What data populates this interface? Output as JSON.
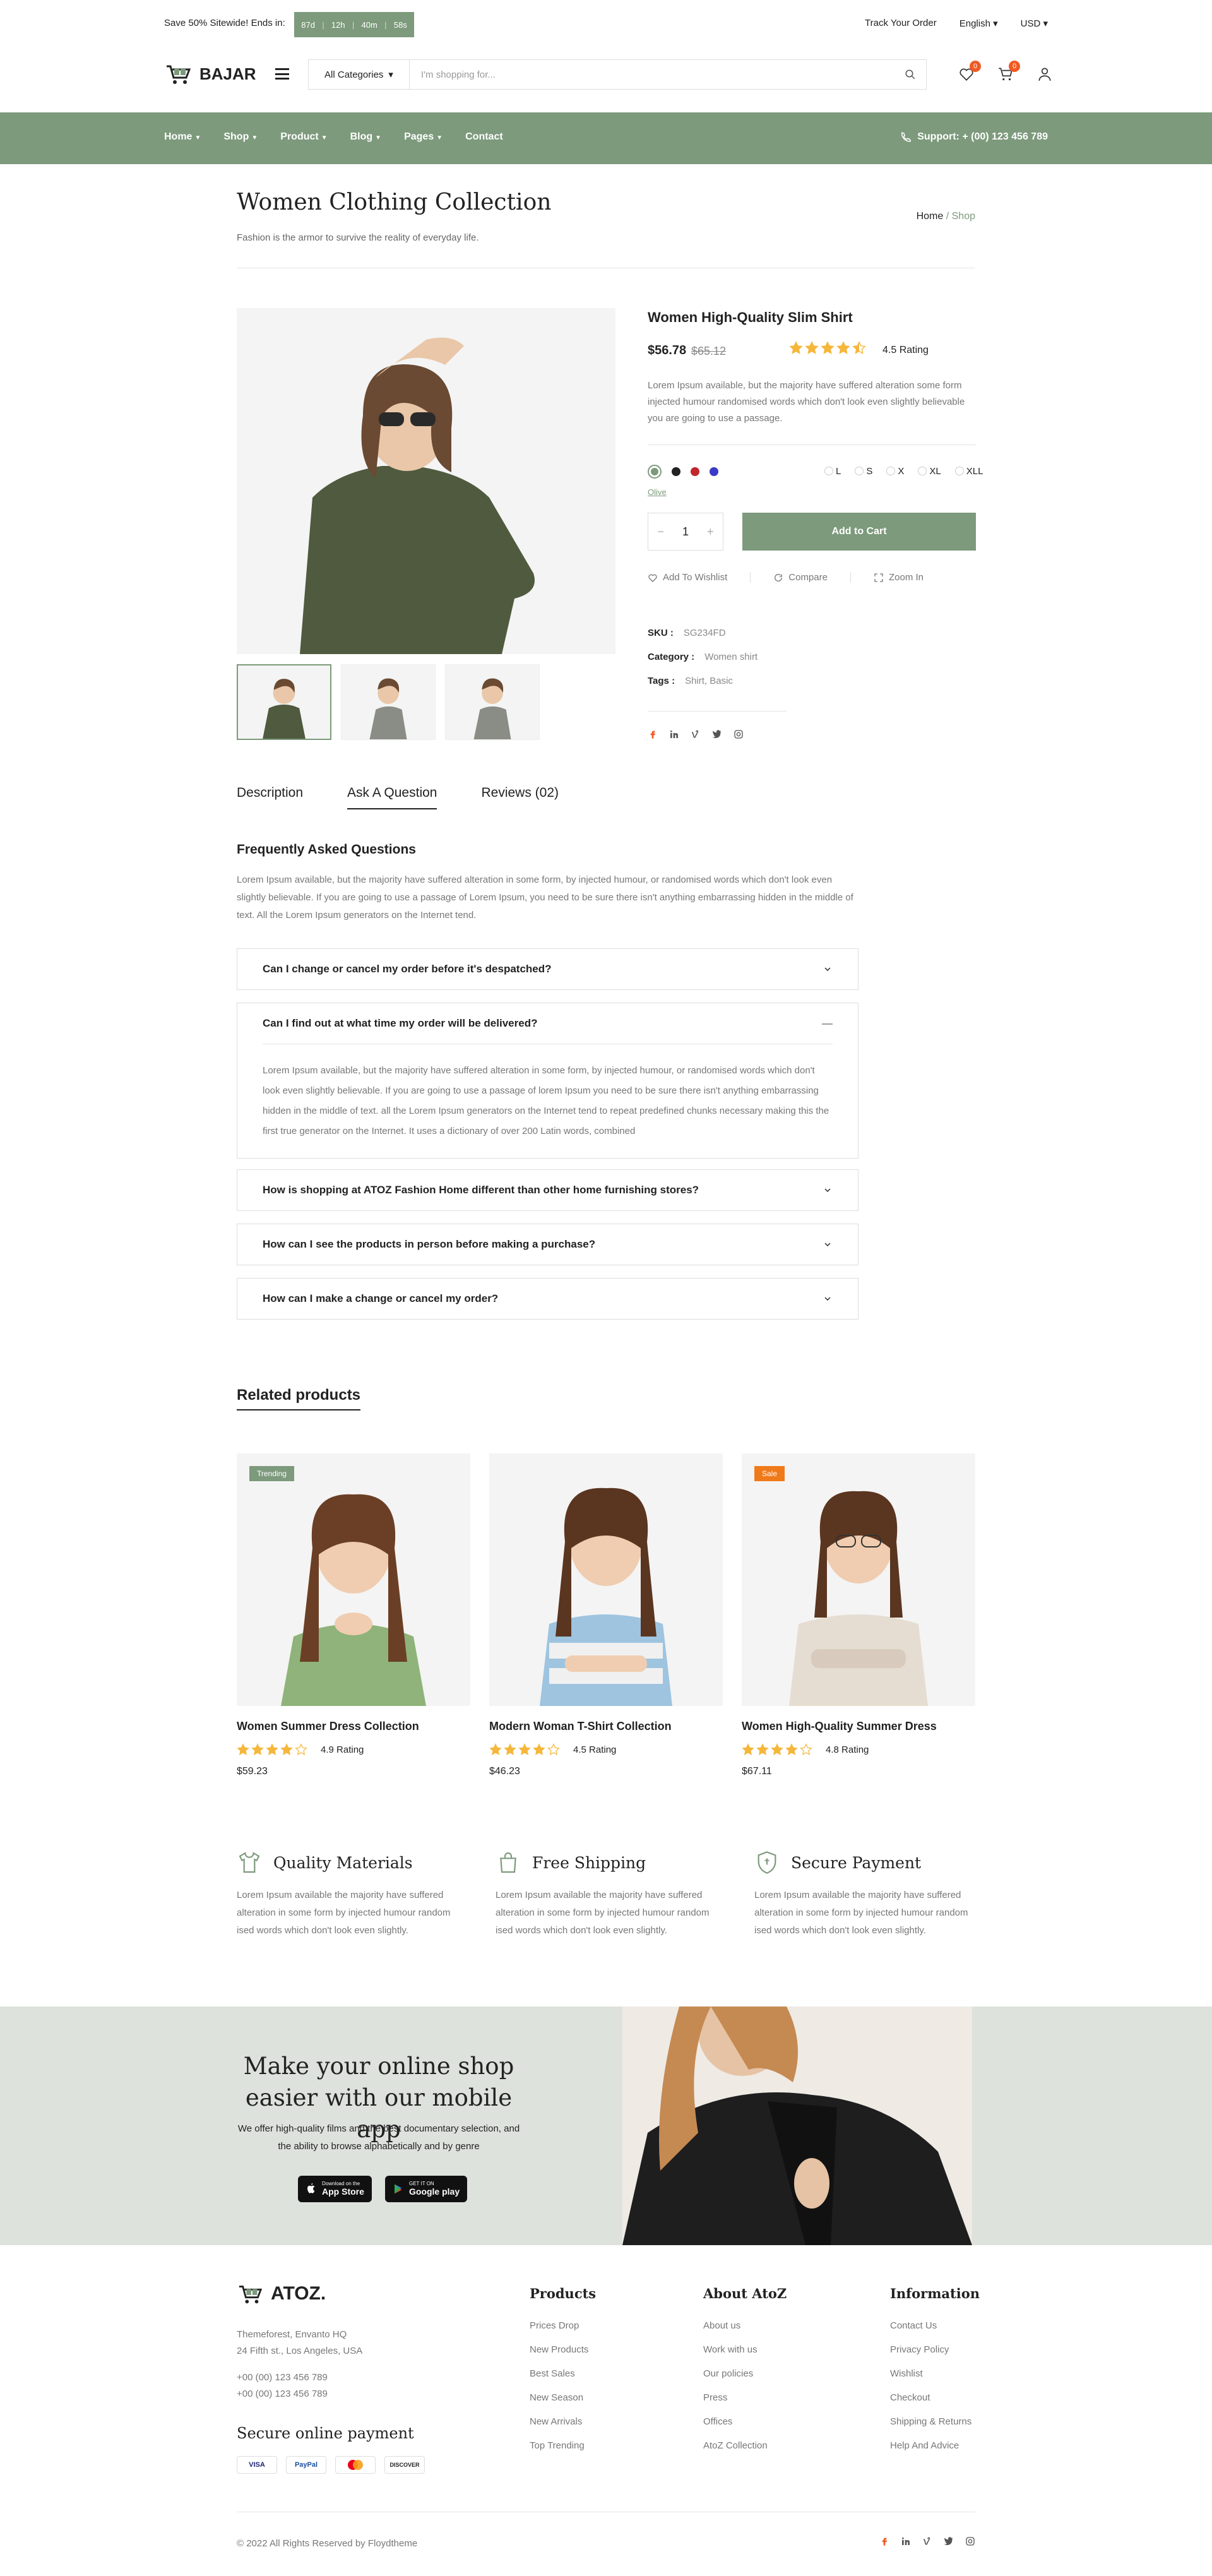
{
  "topbar": {
    "promo": "Save 50% Sitewide! Ends in:",
    "timer": [
      "87d",
      "12h",
      "40m",
      "58s"
    ],
    "track": "Track Your Order",
    "language": "English",
    "currency": "USD"
  },
  "header": {
    "logo": "BAJAR",
    "category": "All Categories",
    "search_placeholder": "I'm shopping for...",
    "wishlist_count": "0",
    "cart_count": "0"
  },
  "nav": {
    "items": [
      "Home",
      "Shop",
      "Product",
      "Blog",
      "Pages",
      "Contact"
    ],
    "support": "Support: + (00) 123 456 789"
  },
  "page": {
    "title": "Women Clothing Collection",
    "subtitle": "Fashion is the armor to survive the reality of everyday life.",
    "breadcrumb_home": "Home",
    "breadcrumb_sep": " / ",
    "breadcrumb_current": "Shop"
  },
  "product": {
    "name": "Women High-Quality Slim Shirt",
    "price": "$56.78",
    "old_price": "$65.12",
    "rating_value": 4.5,
    "rating": "4.5 Rating",
    "description": "Lorem Ipsum available, but the majority have suffered alteration some form injected humour randomised words which don't look even slightly believable you are going to use a passage.",
    "colors": [
      "#7d9a7c",
      "#222222",
      "#c0262c",
      "#3a3ac8"
    ],
    "color_name": "Olive",
    "sizes": [
      "L",
      "S",
      "X",
      "XL",
      "XLL"
    ],
    "quantity": "1",
    "add_to_cart": "Add to Cart",
    "wishlist": "Add To Wishlist",
    "compare": "Compare",
    "zoom": "Zoom In",
    "sku_label": "SKU :",
    "sku": "SG234FD",
    "category_label": "Category :",
    "category": "Women shirt",
    "tags_label": "Tags :",
    "tags": "Shirt, Basic"
  },
  "tabs": [
    "Description",
    "Ask A Question",
    "Reviews (02)"
  ],
  "faq": {
    "heading": "Frequently Asked Questions",
    "intro": "Lorem Ipsum available, but the majority have suffered alteration in some form, by injected humour, or randomised words which don't look even slightly believable. If you are going to use a passage of Lorem Ipsum, you need to be sure there isn't anything embarrassing hidden in the middle of text. All the Lorem Ipsum generators on the Internet tend.",
    "items": [
      {
        "q": "Can I change or cancel my order before it's despatched?"
      },
      {
        "q": "Can I find out at what time my order will be delivered?",
        "a": "Lorem Ipsum available, but the majority have suffered alteration in some form, by injected humour, or randomised words which don't look even slightly believable. If you are going to use a passage of lorem Ipsum you need to be sure there isn't anything embarrassing hidden in the middle of text. all the Lorem Ipsum generators on the Internet tend to repeat predefined chunks necessary making this the first true generator on the Internet. It uses a dictionary of over 200 Latin words, combined"
      },
      {
        "q": "How is shopping at ATOZ Fashion Home different than other home furnishing stores?"
      },
      {
        "q": "How can I see the products in person before making a purchase?"
      },
      {
        "q": "How can I make a change or cancel my order?"
      }
    ]
  },
  "related": {
    "heading": "Related products",
    "items": [
      {
        "tag": "Trending",
        "tag_color": "#7d9a7c",
        "name": "Women Summer Dress Collection",
        "rating_value": 4,
        "rating": "4.9 Rating",
        "price": "$59.23"
      },
      {
        "tag": "",
        "tag_color": "",
        "name": "Modern Woman T-Shirt Collection",
        "rating_value": 4,
        "rating": "4.5 Rating",
        "price": "$46.23"
      },
      {
        "tag": "Sale",
        "tag_color": "#f07a1a",
        "name": "Women High-Quality Summer Dress",
        "rating_value": 4,
        "rating": "4.8 Rating",
        "price": "$67.11"
      }
    ]
  },
  "features": [
    {
      "icon": "shirt-icon",
      "title": "Quality Materials",
      "text": "Lorem Ipsum available the majority have suffered alteration in some form by injected humour random ised words which don't look even slightly."
    },
    {
      "icon": "bag-icon",
      "title": "Free Shipping",
      "text": "Lorem Ipsum available the majority have suffered alteration in some form by injected humour random ised words which don't look even slightly."
    },
    {
      "icon": "shield-icon",
      "title": "Secure Payment",
      "text": "Lorem Ipsum available the majority have suffered alteration in some form by injected humour random ised words which don't look even slightly."
    }
  ],
  "banner": {
    "heading": "Make your online shop easier with our mobile app",
    "text": "We offer high-quality films and the best documentary selection, and the ability to browse alphabetically and by genre",
    "appstore_small": "Download on the",
    "appstore": "App Store",
    "googleplay_small": "GET IT ON",
    "googleplay": "Google play"
  },
  "footer": {
    "logo": "ATOZ.",
    "address1": "Themeforest, Envanto HQ",
    "address2": "24 Fifth st., Los Angeles, USA",
    "phone1": "+00 (00) 123 456 789",
    "phone2": "+00 (00) 123 456 789",
    "payment_heading": "Secure online payment",
    "payments": [
      "VISA",
      "PayPal",
      "MC",
      "DISCOVER"
    ],
    "columns": [
      {
        "title": "Products",
        "links": [
          "Prices Drop",
          "New Products",
          "Best Sales",
          "New Season",
          "New Arrivals",
          "Top Trending"
        ]
      },
      {
        "title": "About AtoZ",
        "links": [
          "About us",
          "Work with us",
          "Our policies",
          "Press",
          "Offices",
          "AtoZ Collection"
        ]
      },
      {
        "title": "Information",
        "links": [
          "Contact Us",
          "Privacy Policy",
          "Wishlist",
          "Checkout",
          "Shipping & Returns",
          "Help And Advice"
        ]
      }
    ],
    "copyright": "© 2022 All Rights Reserved by Floydtheme"
  },
  "colors": {
    "accent": "#7d9a7c",
    "badge": "#f05a22",
    "star": "#f5b73b"
  }
}
